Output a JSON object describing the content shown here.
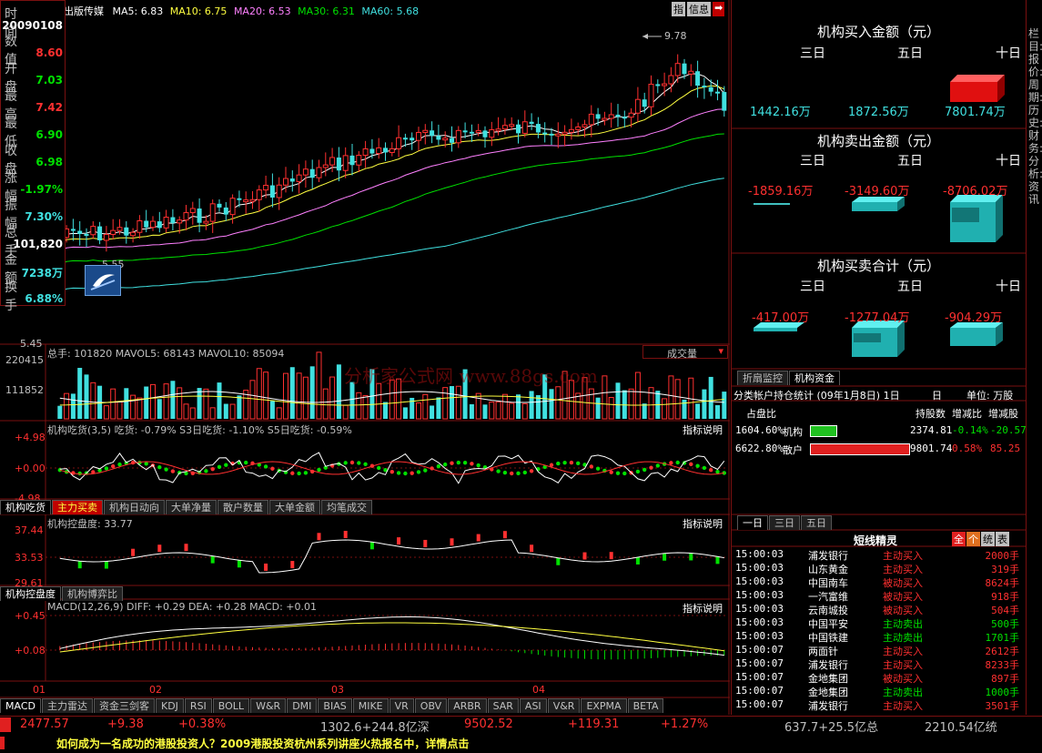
{
  "stock": {
    "name": "出版传媒",
    "ma_line": [
      "MA5: 6.83",
      "MA10: 6.75",
      "MA20: 6.53",
      "MA30: 6.31",
      "MA60: 5.68"
    ],
    "top_buttons": [
      "指",
      "信息",
      "➡"
    ],
    "peak_label": "9.78",
    "low_label": "5.55",
    "ylabel_bottom": "5.45"
  },
  "info_box": {
    "items": [
      {
        "label": "时间",
        "value": "20090108",
        "color": "#ffffff"
      },
      {
        "label": "数值",
        "value": "8.60",
        "color": "#ff3030"
      },
      {
        "label": "开盘",
        "value": "7.03",
        "color": "#00e000"
      },
      {
        "label": "最高",
        "value": "7.42",
        "color": "#ff3030"
      },
      {
        "label": "最低",
        "value": "6.90",
        "color": "#00e000"
      },
      {
        "label": "收盘",
        "value": "6.98",
        "color": "#00e000"
      },
      {
        "label": "涨幅",
        "value": "-1.97%",
        "color": "#00e000"
      },
      {
        "label": "振幅",
        "value": "7.30%",
        "color": "#40e0e0"
      },
      {
        "label": "总手",
        "value": "101,820",
        "color": "#ffffff"
      },
      {
        "label": "金额",
        "value": "7238万",
        "color": "#40e0e0"
      },
      {
        "label": "换手",
        "value": "6.88%",
        "color": "#40e0e0"
      }
    ]
  },
  "volume_panel": {
    "header": "总手: 101820  MAVOL5: 68143  MAVOL10: 85094",
    "dropdown": "成交量",
    "y_ticks": [
      "220415",
      "111852"
    ],
    "watermark": "分析家公式网 www.88gs.com"
  },
  "panel2": {
    "header": "机构吃货(3,5) 吃货: -0.79%  S3日吃货: -1.10%  S5日吃货: -0.59%",
    "help": "指标说明",
    "y_ticks": [
      "+4.98",
      "+0.00",
      "-4.98"
    ],
    "tabs": [
      "机构吃货",
      "主力买卖",
      "机构日动向",
      "大单净量",
      "散户数量",
      "大单金额",
      "均笔成交"
    ]
  },
  "panel3": {
    "header": "机构控盘度: 33.77",
    "help": "指标说明",
    "y_ticks": [
      "37.44",
      "33.53",
      "29.61"
    ],
    "tabs": [
      "机构控盘度",
      "机构博弈比"
    ]
  },
  "panel4": {
    "header": "MACD(12,26,9) DIFF: +0.29  DEA: +0.28  MACD: +0.01",
    "help": "指标说明",
    "y_ticks": [
      "+0.45",
      "+0.08"
    ],
    "x_labels": [
      "01",
      "02",
      "03",
      "04"
    ]
  },
  "bottom_tabs": [
    "MACD",
    "主力雷达",
    "资金三剑客",
    "KDJ",
    "RSI",
    "BOLL",
    "W&R",
    "DMI",
    "BIAS",
    "MIKE",
    "VR",
    "OBV",
    "ARBR",
    "SAR",
    "ASI",
    "V&R",
    "EXPMA",
    "BETA"
  ],
  "right": {
    "buy": {
      "title": "机构买入金额（元）",
      "periods": [
        "三日",
        "五日",
        "十日"
      ],
      "values": [
        "1442.16万",
        "1872.56万",
        "7801.74万"
      ]
    },
    "sell": {
      "title": "机构卖出金额（元）",
      "periods": [
        "三日",
        "五日",
        "十日"
      ],
      "values": [
        "-1859.16万",
        "-3149.60万",
        "-8706.02万"
      ]
    },
    "net": {
      "title": "机构买卖合计（元）",
      "periods": [
        "三日",
        "五日",
        "十日"
      ],
      "values": [
        "-417.00万",
        "-1277.04万",
        "-904.29万"
      ]
    },
    "tabs": [
      "折扇监控",
      "机构资金"
    ],
    "holdings": {
      "title": "分类帐户持仓统计 (09年1月8日)  1日",
      "day": "日",
      "unit": "单位: 万股",
      "cols": [
        "占盘比",
        "持股数",
        "增减比",
        "增减股"
      ],
      "rows": [
        {
          "pct": "1604.60%",
          "label": "机构",
          "shares": "2374.81",
          "ratio": "-0.14%",
          "delta": "-20.57",
          "bar_color": "#20c020"
        },
        {
          "pct": "6622.80%",
          "label": "散户",
          "shares": "9801.74",
          "ratio": "0.58%",
          "delta": "85.25",
          "bar_color": "#e02020"
        }
      ]
    },
    "day_tabs": [
      "一日",
      "三日",
      "五日"
    ],
    "sprite": {
      "title": "短线精灵",
      "buttons": [
        "全",
        "个",
        "统",
        "表"
      ],
      "rows": [
        {
          "time": "15:00:03",
          "name": "浦发银行",
          "action": "主动买入",
          "vol": "2000手"
        },
        {
          "time": "15:00:03",
          "name": "山东黄金",
          "action": "主动买入",
          "vol": "319手"
        },
        {
          "time": "15:00:03",
          "name": "中国南车",
          "action": "被动买入",
          "vol": "8624手"
        },
        {
          "time": "15:00:03",
          "name": "一汽富维",
          "action": "被动买入",
          "vol": "918手"
        },
        {
          "time": "15:00:03",
          "name": "云南城投",
          "action": "被动买入",
          "vol": "504手"
        },
        {
          "time": "15:00:03",
          "name": "中国平安",
          "action": "主动卖出",
          "vol": "500手"
        },
        {
          "time": "15:00:03",
          "name": "中国铁建",
          "action": "主动卖出",
          "vol": "1701手"
        },
        {
          "time": "15:00:07",
          "name": "两面针",
          "action": "主动买入",
          "vol": "2612手"
        },
        {
          "time": "15:00:07",
          "name": "浦发银行",
          "action": "主动买入",
          "vol": "8233手"
        },
        {
          "time": "15:00:07",
          "name": "金地集团",
          "action": "被动买入",
          "vol": "897手"
        },
        {
          "time": "15:00:07",
          "name": "金地集团",
          "action": "主动卖出",
          "vol": "1000手"
        },
        {
          "time": "15:00:07",
          "name": "浦发银行",
          "action": "主动买入",
          "vol": "3501手"
        }
      ]
    }
  },
  "far_right_text": "栏目:报价:周期:历史:财务:分析:资讯",
  "status": {
    "items": [
      {
        "text": "2477.57",
        "color": "#ff3030"
      },
      {
        "text": "+9.38",
        "color": "#ff3030"
      },
      {
        "text": "+0.38%",
        "color": "#ff3030"
      },
      {
        "text": "1302.6+244.8亿深",
        "color": "#c0c0c0"
      },
      {
        "text": "9502.52",
        "color": "#ff3030"
      },
      {
        "text": "+119.31",
        "color": "#ff3030"
      },
      {
        "text": "+1.27%",
        "color": "#ff3030"
      },
      {
        "text": "637.7+25.5亿总",
        "color": "#c0c0c0"
      },
      {
        "text": "2210.54亿统",
        "color": "#c0c0c0"
      }
    ]
  },
  "ticker": "如何成为一名成功的港股投资人？2009港股投资杭州系列讲座火热报名中，详情点击"
}
